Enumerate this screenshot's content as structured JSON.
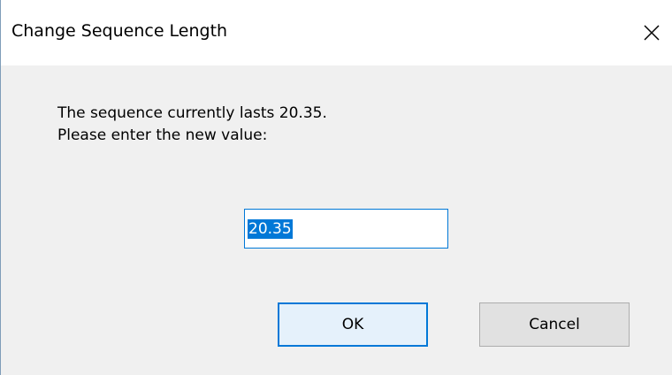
{
  "window": {
    "title": "Change Sequence Length"
  },
  "message": {
    "line1": "The sequence currently lasts 20.35.",
    "line2": "Please enter the new value:"
  },
  "input": {
    "value": "20.35"
  },
  "buttons": {
    "ok_label": "OK",
    "cancel_label": "Cancel"
  },
  "colors": {
    "accent": "#0078d7",
    "dialog_background": "#f0f0f0",
    "button_background": "#e1e1e1"
  },
  "icons": {
    "close": "close-icon"
  }
}
